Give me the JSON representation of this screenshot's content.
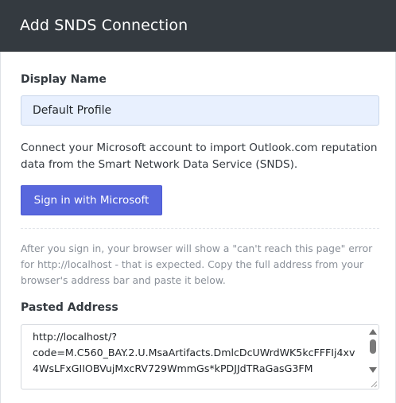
{
  "header": {
    "title": "Add SNDS Connection"
  },
  "form": {
    "display_name_label": "Display Name",
    "display_name_value": "Default Profile",
    "description": "Connect your Microsoft account to import Outlook.com reputation data from the Smart Network Data Service (SNDS).",
    "signin_button_label": "Sign in with Microsoft",
    "help_text": "After you sign in, your browser will show a \"can't reach this page\" error for http://localhost - that is expected. Copy the full address from your browser's address bar and paste it below.",
    "pasted_address_label": "Pasted Address",
    "pasted_address_value": "http://localhost/?\ncode=M.C560_BAY.2.U.MsaArtifacts.DmlcDcUWrdWK5kcFFFIj4xv4WsLFxGIIOBVujMxcRV729WmmGs*kPDJJdTRaGasG3FM"
  },
  "colors": {
    "header_bg": "#343a40",
    "primary_button": "#5867dd",
    "input_bg": "#e8f0fe"
  },
  "icons": {
    "scroll_up": "triangle-up-icon",
    "scroll_down": "triangle-down-icon",
    "resize": "resize-grip-icon"
  }
}
